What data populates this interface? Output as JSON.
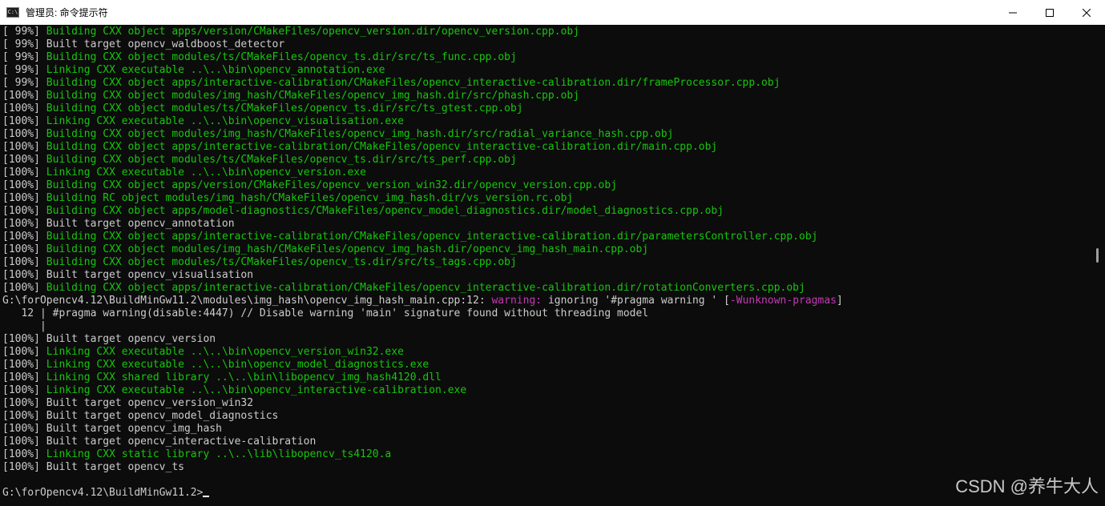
{
  "window": {
    "title": "管理员: 命令提示符",
    "icon_label": "C:\\",
    "controls": {
      "minimize": "minimize-icon",
      "maximize": "maximize-icon",
      "close": "close-icon"
    }
  },
  "colors": {
    "green": "#16c60c",
    "white": "#cccccc",
    "magenta": "#c239b3",
    "background": "#0c0c0c"
  },
  "console": {
    "lines": [
      {
        "parts": [
          {
            "t": "[ 99%] ",
            "c": "w"
          },
          {
            "t": "Building CXX object apps/version/CMakeFiles/opencv_version.dir/opencv_version.cpp.obj",
            "c": "g"
          }
        ]
      },
      {
        "parts": [
          {
            "t": "[ 99%] Built target opencv_waldboost_detector",
            "c": "w"
          }
        ]
      },
      {
        "parts": [
          {
            "t": "[ 99%] ",
            "c": "w"
          },
          {
            "t": "Building CXX object modules/ts/CMakeFiles/opencv_ts.dir/src/ts_func.cpp.obj",
            "c": "g"
          }
        ]
      },
      {
        "parts": [
          {
            "t": "[ 99%] ",
            "c": "w"
          },
          {
            "t": "Linking CXX executable ..\\..\\bin\\opencv_annotation.exe",
            "c": "g"
          }
        ]
      },
      {
        "parts": [
          {
            "t": "[ 99%] ",
            "c": "w"
          },
          {
            "t": "Building CXX object apps/interactive-calibration/CMakeFiles/opencv_interactive-calibration.dir/frameProcessor.cpp.obj",
            "c": "g"
          }
        ]
      },
      {
        "parts": [
          {
            "t": "[100%] ",
            "c": "w"
          },
          {
            "t": "Building CXX object modules/img_hash/CMakeFiles/opencv_img_hash.dir/src/phash.cpp.obj",
            "c": "g"
          }
        ]
      },
      {
        "parts": [
          {
            "t": "[100%] ",
            "c": "w"
          },
          {
            "t": "Building CXX object modules/ts/CMakeFiles/opencv_ts.dir/src/ts_gtest.cpp.obj",
            "c": "g"
          }
        ]
      },
      {
        "parts": [
          {
            "t": "[100%] ",
            "c": "w"
          },
          {
            "t": "Linking CXX executable ..\\..\\bin\\opencv_visualisation.exe",
            "c": "g"
          }
        ]
      },
      {
        "parts": [
          {
            "t": "[100%] ",
            "c": "w"
          },
          {
            "t": "Building CXX object modules/img_hash/CMakeFiles/opencv_img_hash.dir/src/radial_variance_hash.cpp.obj",
            "c": "g"
          }
        ]
      },
      {
        "parts": [
          {
            "t": "[100%] ",
            "c": "w"
          },
          {
            "t": "Building CXX object apps/interactive-calibration/CMakeFiles/opencv_interactive-calibration.dir/main.cpp.obj",
            "c": "g"
          }
        ]
      },
      {
        "parts": [
          {
            "t": "[100%] ",
            "c": "w"
          },
          {
            "t": "Building CXX object modules/ts/CMakeFiles/opencv_ts.dir/src/ts_perf.cpp.obj",
            "c": "g"
          }
        ]
      },
      {
        "parts": [
          {
            "t": "[100%] ",
            "c": "w"
          },
          {
            "t": "Linking CXX executable ..\\..\\bin\\opencv_version.exe",
            "c": "g"
          }
        ]
      },
      {
        "parts": [
          {
            "t": "[100%] ",
            "c": "w"
          },
          {
            "t": "Building CXX object apps/version/CMakeFiles/opencv_version_win32.dir/opencv_version.cpp.obj",
            "c": "g"
          }
        ]
      },
      {
        "parts": [
          {
            "t": "[100%] ",
            "c": "w"
          },
          {
            "t": "Building RC object modules/img_hash/CMakeFiles/opencv_img_hash.dir/vs_version.rc.obj",
            "c": "g"
          }
        ]
      },
      {
        "parts": [
          {
            "t": "[100%] ",
            "c": "w"
          },
          {
            "t": "Building CXX object apps/model-diagnostics/CMakeFiles/opencv_model_diagnostics.dir/model_diagnostics.cpp.obj",
            "c": "g"
          }
        ]
      },
      {
        "parts": [
          {
            "t": "[100%] Built target opencv_annotation",
            "c": "w"
          }
        ]
      },
      {
        "parts": [
          {
            "t": "[100%] ",
            "c": "w"
          },
          {
            "t": "Building CXX object apps/interactive-calibration/CMakeFiles/opencv_interactive-calibration.dir/parametersController.cpp.obj",
            "c": "g"
          }
        ]
      },
      {
        "parts": [
          {
            "t": "[100%] ",
            "c": "w"
          },
          {
            "t": "Building CXX object modules/img_hash/CMakeFiles/opencv_img_hash.dir/opencv_img_hash_main.cpp.obj",
            "c": "g"
          }
        ]
      },
      {
        "parts": [
          {
            "t": "[100%] ",
            "c": "w"
          },
          {
            "t": "Building CXX object modules/ts/CMakeFiles/opencv_ts.dir/src/ts_tags.cpp.obj",
            "c": "g"
          }
        ]
      },
      {
        "parts": [
          {
            "t": "[100%] Built target opencv_visualisation",
            "c": "w"
          }
        ]
      },
      {
        "parts": [
          {
            "t": "[100%] ",
            "c": "w"
          },
          {
            "t": "Building CXX object apps/interactive-calibration/CMakeFiles/opencv_interactive-calibration.dir/rotationConverters.cpp.obj",
            "c": "g"
          }
        ]
      },
      {
        "parts": [
          {
            "t": "G:\\forOpencv4.12\\BuildMinGw11.2\\modules\\img_hash\\opencv_img_hash_main.cpp:12: ",
            "c": "w"
          },
          {
            "t": "warning: ",
            "c": "m"
          },
          {
            "t": "ignoring '#pragma warning ' [",
            "c": "w"
          },
          {
            "t": "-Wunknown-pragmas",
            "c": "m"
          },
          {
            "t": "]",
            "c": "w"
          }
        ]
      },
      {
        "parts": [
          {
            "t": "   12 | #pragma warning(disable:4447) // Disable warning 'main' signature found without threading model",
            "c": "w"
          }
        ]
      },
      {
        "parts": [
          {
            "t": "      |",
            "c": "w"
          }
        ]
      },
      {
        "parts": [
          {
            "t": "[100%] Built target opencv_version",
            "c": "w"
          }
        ]
      },
      {
        "parts": [
          {
            "t": "[100%] ",
            "c": "w"
          },
          {
            "t": "Linking CXX executable ..\\..\\bin\\opencv_version_win32.exe",
            "c": "g"
          }
        ]
      },
      {
        "parts": [
          {
            "t": "[100%] ",
            "c": "w"
          },
          {
            "t": "Linking CXX executable ..\\..\\bin\\opencv_model_diagnostics.exe",
            "c": "g"
          }
        ]
      },
      {
        "parts": [
          {
            "t": "[100%] ",
            "c": "w"
          },
          {
            "t": "Linking CXX shared library ..\\..\\bin\\libopencv_img_hash4120.dll",
            "c": "g"
          }
        ]
      },
      {
        "parts": [
          {
            "t": "[100%] ",
            "c": "w"
          },
          {
            "t": "Linking CXX executable ..\\..\\bin\\opencv_interactive-calibration.exe",
            "c": "g"
          }
        ]
      },
      {
        "parts": [
          {
            "t": "[100%] Built target opencv_version_win32",
            "c": "w"
          }
        ]
      },
      {
        "parts": [
          {
            "t": "[100%] Built target opencv_model_diagnostics",
            "c": "w"
          }
        ]
      },
      {
        "parts": [
          {
            "t": "[100%] Built target opencv_img_hash",
            "c": "w"
          }
        ]
      },
      {
        "parts": [
          {
            "t": "[100%] Built target opencv_interactive-calibration",
            "c": "w"
          }
        ]
      },
      {
        "parts": [
          {
            "t": "[100%] ",
            "c": "w"
          },
          {
            "t": "Linking CXX static library ..\\..\\lib\\libopencv_ts4120.a",
            "c": "g"
          }
        ]
      },
      {
        "parts": [
          {
            "t": "[100%] Built target opencv_ts",
            "c": "w"
          }
        ]
      },
      {
        "parts": []
      },
      {
        "parts": [
          {
            "t": "G:\\forOpencv4.12\\BuildMinGw11.2>",
            "c": "w"
          }
        ],
        "cursor": true
      }
    ]
  },
  "watermark": "CSDN @养牛大人"
}
